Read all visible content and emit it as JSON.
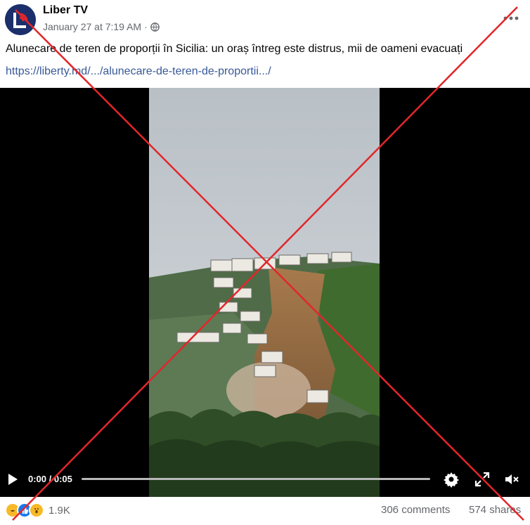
{
  "post": {
    "page_name": "Liber TV",
    "timestamp": "January 27 at 7:19 AM",
    "separator": "·",
    "avatar_letter": "L",
    "text": "Alunecare de teren de proporții în Sicilia: un oraș întreg este distrus, mii de oameni evacuați",
    "link": "https://liberty.md/.../alunecare-de-teren-de-proportii.../"
  },
  "video": {
    "current_time": "0:00",
    "duration": "0:05",
    "time_display": "0:00 / 0:05",
    "progress_fraction": 0.0
  },
  "engagement": {
    "reaction_count": "1.9K",
    "comments": "306 comments",
    "shares": "574 shares",
    "reaction_icons": [
      "haha-icon",
      "like-icon",
      "wow-icon"
    ]
  },
  "colors": {
    "link": "#385898",
    "muted": "#65676b",
    "like": "#1877f2",
    "x_overlay": "#e2262b"
  }
}
